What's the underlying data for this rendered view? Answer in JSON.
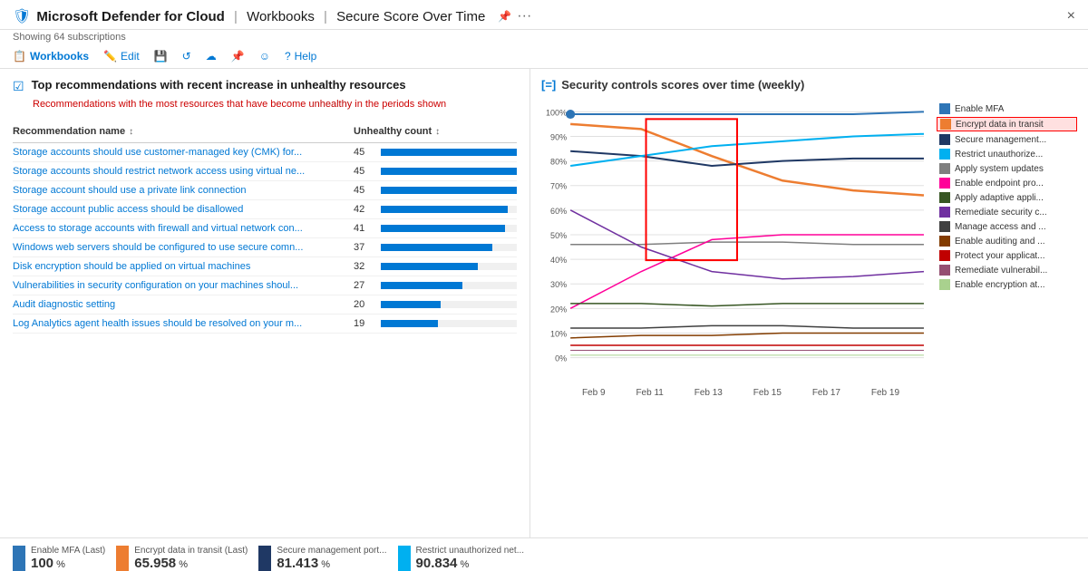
{
  "header": {
    "title": "Microsoft Defender for Cloud",
    "separator1": "|",
    "section": "Workbooks",
    "separator2": "|",
    "page": "Secure Score Over Time",
    "subtitle": "Showing 64 subscriptions",
    "close_label": "×"
  },
  "toolbar": {
    "items": [
      {
        "id": "workbooks",
        "label": "Workbooks",
        "icon": "📋",
        "active": true
      },
      {
        "id": "edit",
        "label": "Edit",
        "icon": "✏️"
      },
      {
        "id": "save",
        "label": "",
        "icon": "💾"
      },
      {
        "id": "refresh",
        "label": "",
        "icon": "↺"
      },
      {
        "id": "cloud",
        "label": "",
        "icon": "☁"
      },
      {
        "id": "pin",
        "label": "",
        "icon": "📌"
      },
      {
        "id": "smiley",
        "label": "",
        "icon": "☺"
      },
      {
        "id": "help",
        "label": "Help",
        "icon": "?"
      }
    ]
  },
  "left": {
    "section_title": "Top recommendations with recent increase in unhealthy resources",
    "section_desc_part1": "Recommendations with the most resources that have become ",
    "section_desc_highlight": "unhealthy",
    "section_desc_part2": " in the periods shown",
    "col_name": "Recommendation name",
    "col_count": "Unhealthy count",
    "rows": [
      {
        "name": "Storage accounts should use customer-managed key (CMK) for...",
        "count": 45,
        "max": 45
      },
      {
        "name": "Storage accounts should restrict network access using virtual ne...",
        "count": 45,
        "max": 45
      },
      {
        "name": "Storage account should use a private link connection",
        "count": 45,
        "max": 45
      },
      {
        "name": "Storage account public access should be disallowed",
        "count": 42,
        "max": 45
      },
      {
        "name": "Access to storage accounts with firewall and virtual network con...",
        "count": 41,
        "max": 45
      },
      {
        "name": "Windows web servers should be configured to use secure comn...",
        "count": 37,
        "max": 45
      },
      {
        "name": "Disk encryption should be applied on virtual machines",
        "count": 32,
        "max": 45
      },
      {
        "name": "Vulnerabilities in security configuration on your machines shoul...",
        "count": 27,
        "max": 45
      },
      {
        "name": "Audit diagnostic setting",
        "count": 20,
        "max": 45
      },
      {
        "name": "Log Analytics agent health issues should be resolved on your m...",
        "count": 19,
        "max": 45
      }
    ]
  },
  "right": {
    "chart_title": "Security controls scores over time (weekly)",
    "y_labels": [
      "100%",
      "90%",
      "80%",
      "70%",
      "60%",
      "50%",
      "40%",
      "30%",
      "20%",
      "10%",
      "0%"
    ],
    "x_labels": [
      "Feb 9",
      "Feb 11",
      "Feb 13",
      "Feb 15",
      "Feb 17",
      "Feb 19"
    ],
    "legend": [
      {
        "id": "enable_mfa",
        "label": "Enable MFA",
        "color": "#2e75b6"
      },
      {
        "id": "encrypt_transit",
        "label": "Encrypt data in transit",
        "color": "#ed7d31",
        "highlighted": true
      },
      {
        "id": "secure_mgmt",
        "label": "Secure management...",
        "color": "#1f3864"
      },
      {
        "id": "restrict_unauth",
        "label": "Restrict unauthorize...",
        "color": "#00b0f0"
      },
      {
        "id": "apply_updates",
        "label": "Apply system updates",
        "color": "#7f7f7f"
      },
      {
        "id": "enable_endpoint",
        "label": "Enable endpoint pro...",
        "color": "#ff0099"
      },
      {
        "id": "apply_adaptive",
        "label": "Apply adaptive appli...",
        "color": "#375623"
      },
      {
        "id": "remediate_sec",
        "label": "Remediate security c...",
        "color": "#7030a0"
      },
      {
        "id": "manage_access",
        "label": "Manage access and ...",
        "color": "#404040"
      },
      {
        "id": "enable_auditing",
        "label": "Enable auditing and ...",
        "color": "#833c00"
      },
      {
        "id": "protect_app",
        "label": "Protect your applicat...",
        "color": "#c00000"
      },
      {
        "id": "remediate_vuln",
        "label": "Remediate vulnerabil...",
        "color": "#954f72"
      },
      {
        "id": "enable_encrypt",
        "label": "Enable encryption at...",
        "color": "#a9d18e"
      }
    ]
  },
  "metrics": [
    {
      "id": "enable_mfa",
      "label": "Enable MFA (Last)",
      "value": "100",
      "unit": "%",
      "color": "#2e75b6"
    },
    {
      "id": "encrypt_transit",
      "label": "Encrypt data in transit (Last)",
      "value": "65.958",
      "unit": "%",
      "color": "#ed7d31"
    },
    {
      "id": "secure_mgmt",
      "label": "Secure management port...",
      "value": "81.413",
      "unit": "%",
      "color": "#1f3864"
    },
    {
      "id": "restrict_unauth",
      "label": "Restrict unauthorized net...",
      "value": "90.834",
      "unit": "%",
      "color": "#00b0f0"
    }
  ],
  "icons": {
    "filter_icon": "⚡",
    "chart_icon": "📈",
    "pin_icon": "📌",
    "more_icon": "···"
  }
}
